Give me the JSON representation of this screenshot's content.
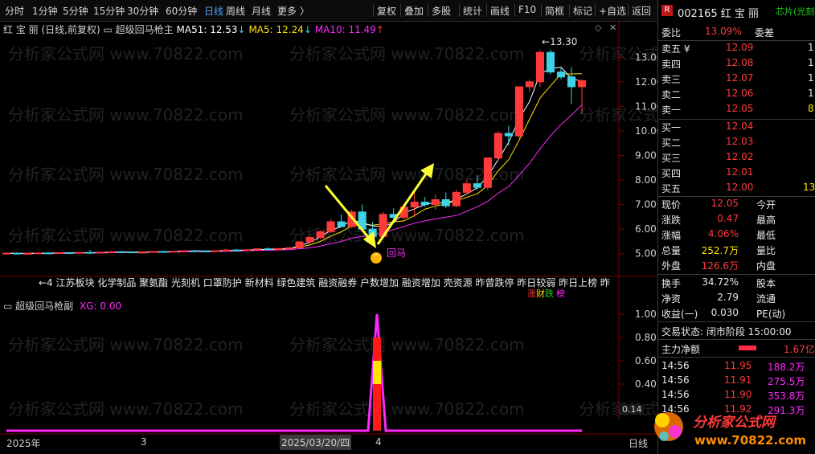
{
  "toolbar": {
    "left": [
      {
        "label": "分时",
        "active": false
      },
      {
        "label": "1分钟",
        "active": false
      },
      {
        "label": "5分钟",
        "active": false
      },
      {
        "label": "15分钟",
        "active": false
      },
      {
        "label": "30分钟",
        "active": false
      },
      {
        "label": "60分钟",
        "active": false
      },
      {
        "label": "日线",
        "active": true
      },
      {
        "label": "周线",
        "active": false
      },
      {
        "label": "月线",
        "active": false
      },
      {
        "label": "更多 〉",
        "active": false
      }
    ],
    "right": [
      "复权",
      "叠加",
      "多股",
      "统计",
      "画线",
      "F10",
      "简框",
      "标记",
      "+自选",
      "返回"
    ]
  },
  "chart_header": {
    "stock": "红 宝 丽",
    "mode": "(日线,前复权)",
    "indicator": "超级回马枪主",
    "ma51_label": "MA51: 12.53",
    "ma5_label": "MA5: 12.24",
    "ma10_label": "MA10: 11.49"
  },
  "lower_header": {
    "indicator": "超级回马枪副",
    "xg_label": "XG: 0.00"
  },
  "annotations": {
    "high_label": "13.30",
    "signal_label": "回马",
    "concepts": "←4 江苏板块  化学制品  聚氨酯  光刻机  口罩防护  新材料  绿色建筑   融资融券  户数增加  融资增加  壳资源  昨曾跌停  昨日较弱  昨日上榜  昨",
    "badge_zhang": "涨",
    "badge_cai": "财",
    "badge_die": "跌",
    "badge_bang": "榜"
  },
  "date_axis": {
    "year": "2025年",
    "m3": "3",
    "cursor_date": "2025/03/20/四",
    "m4": "4",
    "period": "日线"
  },
  "watermark": "分析家公式网 www.70822.com",
  "logo": {
    "name": "分析家公式网",
    "url": "www.70822.com"
  },
  "right_panel": {
    "code_name": "002165 红 宝 丽",
    "tag": "芯片(光刻",
    "weibi_label": "委比",
    "weibi_value": "13.09%",
    "weicha_label": "委差",
    "asks": [
      {
        "label": "卖五 ¥",
        "price": "12.09",
        "vol": "1"
      },
      {
        "label": "卖四",
        "price": "12.08",
        "vol": "1"
      },
      {
        "label": "卖三",
        "price": "12.07",
        "vol": "1"
      },
      {
        "label": "卖二",
        "price": "12.06",
        "vol": "1"
      },
      {
        "label": "卖一",
        "price": "12.05",
        "vol": "8"
      }
    ],
    "bids": [
      {
        "label": "买一",
        "price": "12.04",
        "vol": ""
      },
      {
        "label": "买二",
        "price": "12.03",
        "vol": ""
      },
      {
        "label": "买三",
        "price": "12.02",
        "vol": ""
      },
      {
        "label": "买四",
        "price": "12.01",
        "vol": ""
      },
      {
        "label": "买五",
        "price": "12.00",
        "vol": "13"
      }
    ],
    "quote": [
      {
        "l1": "现价",
        "v1": "12.05",
        "l2": "今开"
      },
      {
        "l1": "涨跌",
        "v1": "0.47",
        "l2": "最高"
      },
      {
        "l1": "涨幅",
        "v1": "4.06%",
        "l2": "最低"
      },
      {
        "l1": "总量",
        "v1": "252.7万",
        "l2": "量比"
      },
      {
        "l1": "外盘",
        "v1": "126.6万",
        "l2": "内盘"
      }
    ],
    "quote2": [
      {
        "l1": "换手",
        "v1": "34.72%",
        "l2": "股本"
      },
      {
        "l1": "净资",
        "v1": "2.79",
        "l2": "流通"
      },
      {
        "l1": "收益(一)",
        "v1": "0.030",
        "l2": "PE(动)"
      }
    ],
    "status_label": "交易状态: 闭市阶段 15:00:00",
    "main_flow_label": "主力净额",
    "main_flow_value": "1.67亿",
    "ticks": [
      {
        "time": "14:56",
        "price": "11.95",
        "vol": "188.2万"
      },
      {
        "time": "14:56",
        "price": "11.91",
        "vol": "275.5万"
      },
      {
        "time": "14:56",
        "price": "11.90",
        "vol": "353.8万"
      },
      {
        "time": "14:56",
        "price": "11.92",
        "vol": "291.3万"
      }
    ]
  },
  "chart_data": [
    {
      "type": "candlestick",
      "title": "超级回马枪主",
      "y_ticks": [
        "13.00",
        "12.00",
        "11.00",
        "10.00",
        "9.00",
        "8.00",
        "7.00",
        "6.00",
        "5.00"
      ],
      "ylim": [
        4.5,
        13.5
      ],
      "candles": [
        [
          5.0,
          5.04,
          4.96,
          5.02
        ],
        [
          5.02,
          5.05,
          4.98,
          5.0
        ],
        [
          5.0,
          5.03,
          4.97,
          5.01
        ],
        [
          5.01,
          5.04,
          4.98,
          5.03
        ],
        [
          5.03,
          5.06,
          5.0,
          5.02
        ],
        [
          5.02,
          5.05,
          4.99,
          5.04
        ],
        [
          5.04,
          5.07,
          5.01,
          5.03
        ],
        [
          5.03,
          5.06,
          5.0,
          5.05
        ],
        [
          5.05,
          5.15,
          5.02,
          5.04
        ],
        [
          5.04,
          5.08,
          5.0,
          5.06
        ],
        [
          5.06,
          5.1,
          5.03,
          5.08
        ],
        [
          5.08,
          5.12,
          5.05,
          5.07
        ],
        [
          5.07,
          5.1,
          5.03,
          5.05
        ],
        [
          5.05,
          5.08,
          5.02,
          5.06
        ],
        [
          5.06,
          5.1,
          5.04,
          5.09
        ],
        [
          5.09,
          5.13,
          5.06,
          5.08
        ],
        [
          5.08,
          5.11,
          5.05,
          5.1
        ],
        [
          5.1,
          5.14,
          5.07,
          5.12
        ],
        [
          5.12,
          5.16,
          5.09,
          5.11
        ],
        [
          5.11,
          5.14,
          5.08,
          5.1
        ],
        [
          5.1,
          5.13,
          5.07,
          5.12
        ],
        [
          5.12,
          5.18,
          5.1,
          5.15
        ],
        [
          5.15,
          5.2,
          5.12,
          5.14
        ],
        [
          5.14,
          5.18,
          5.1,
          5.16
        ],
        [
          5.16,
          5.22,
          5.13,
          5.2
        ],
        [
          5.2,
          5.26,
          5.16,
          5.18
        ],
        [
          5.18,
          5.22,
          5.14,
          5.21
        ],
        [
          5.21,
          5.26,
          5.18,
          5.24
        ],
        [
          5.24,
          5.5,
          5.2,
          5.48
        ],
        [
          5.48,
          5.7,
          5.4,
          5.66
        ],
        [
          5.66,
          5.95,
          5.6,
          5.9
        ],
        [
          5.9,
          6.4,
          5.85,
          6.3
        ],
        [
          6.3,
          6.6,
          6.2,
          6.1
        ],
        [
          6.1,
          6.8,
          6.05,
          6.7
        ],
        [
          6.7,
          7.0,
          6.3,
          6.0
        ],
        [
          6.0,
          6.3,
          5.6,
          5.7
        ],
        [
          5.7,
          6.7,
          5.65,
          6.6
        ],
        [
          6.6,
          6.85,
          6.4,
          6.48
        ],
        [
          6.48,
          6.95,
          6.4,
          6.9
        ],
        [
          6.9,
          7.55,
          6.5,
          7.1
        ],
        [
          7.1,
          7.3,
          6.9,
          7.0
        ],
        [
          7.0,
          7.4,
          6.8,
          7.2
        ],
        [
          7.2,
          7.5,
          6.85,
          6.95
        ],
        [
          6.95,
          7.6,
          6.9,
          7.5
        ],
        [
          7.5,
          8.0,
          7.4,
          7.85
        ],
        [
          7.85,
          8.2,
          7.6,
          7.7
        ],
        [
          7.7,
          8.9,
          7.6,
          8.9
        ],
        [
          8.9,
          10.0,
          8.8,
          9.9
        ],
        [
          9.9,
          10.2,
          9.4,
          9.8
        ],
        [
          9.8,
          11.8,
          9.7,
          11.8
        ],
        [
          11.8,
          12.1,
          11.6,
          12.0
        ],
        [
          12.0,
          13.3,
          11.8,
          13.2
        ],
        [
          13.2,
          13.3,
          12.3,
          12.4
        ],
        [
          12.4,
          12.6,
          12.1,
          12.2
        ],
        [
          12.2,
          12.6,
          11.1,
          11.8
        ],
        [
          11.8,
          12.1,
          10.7,
          12.05
        ]
      ],
      "ma_series": [
        {
          "name": "MA5",
          "color": "#ffe600"
        },
        {
          "name": "MA10",
          "color": "#ff29ff"
        },
        {
          "name": "MA51",
          "color": "#ffffff"
        }
      ]
    },
    {
      "type": "line",
      "title": "超级回马枪副",
      "series": [
        {
          "name": "XG",
          "values": "pulse at 2025-03-20"
        }
      ],
      "y_ticks": [
        "1.00",
        "0.80",
        "0.60",
        "0.40"
      ],
      "ylim": [
        0,
        1
      ],
      "pulse": 1.0
    }
  ]
}
